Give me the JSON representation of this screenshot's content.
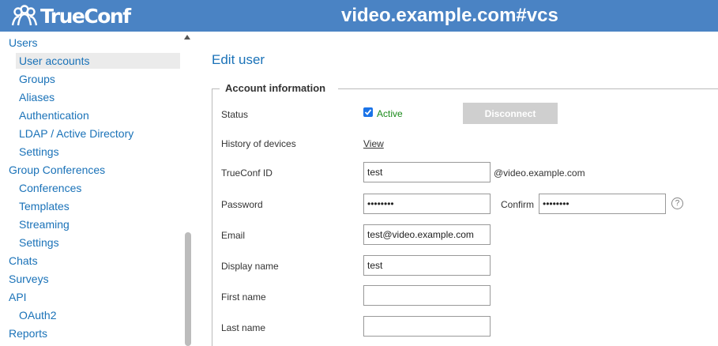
{
  "header": {
    "logo_text": "TrueConf",
    "server_title": "video.example.com#vcs"
  },
  "sidebar": {
    "items": [
      {
        "label": "Users",
        "level": 1
      },
      {
        "label": "User accounts",
        "level": 2,
        "selected": true
      },
      {
        "label": "Groups",
        "level": 2
      },
      {
        "label": "Aliases",
        "level": 2
      },
      {
        "label": "Authentication",
        "level": 2
      },
      {
        "label": "LDAP / Active Directory",
        "level": 2
      },
      {
        "label": "Settings",
        "level": 2
      },
      {
        "label": "Group Conferences",
        "level": 1
      },
      {
        "label": "Conferences",
        "level": 2
      },
      {
        "label": "Templates",
        "level": 2
      },
      {
        "label": "Streaming",
        "level": 2
      },
      {
        "label": "Settings",
        "level": 2
      },
      {
        "label": "Chats",
        "level": 1
      },
      {
        "label": "Surveys",
        "level": 1
      },
      {
        "label": "API",
        "level": 1
      },
      {
        "label": "OAuth2",
        "level": 2
      },
      {
        "label": "Reports",
        "level": 1
      }
    ]
  },
  "main": {
    "page_title": "Edit user",
    "section_title": "Account information",
    "status": {
      "label": "Status",
      "checkbox_label": "Active",
      "checked": true,
      "disconnect_label": "Disconnect"
    },
    "history": {
      "label": "History of devices",
      "link": "View"
    },
    "trueconf_id": {
      "label": "TrueConf ID",
      "value": "test",
      "suffix": "@video.example.com"
    },
    "password": {
      "label": "Password",
      "value": "••••••••",
      "confirm_label": "Confirm",
      "confirm_value": "••••••••",
      "help": "?"
    },
    "email": {
      "label": "Email",
      "value": "test@video.example.com"
    },
    "display_name": {
      "label": "Display name",
      "value": "test"
    },
    "first_name": {
      "label": "First name",
      "value": ""
    },
    "last_name": {
      "label": "Last name",
      "value": ""
    }
  },
  "colors": {
    "header_bg": "#4a83c4",
    "link": "#1a72b8",
    "active_green": "#1a8a1a",
    "checkbox": "#1a73e8",
    "disabled_button": "#cfcfcf"
  }
}
